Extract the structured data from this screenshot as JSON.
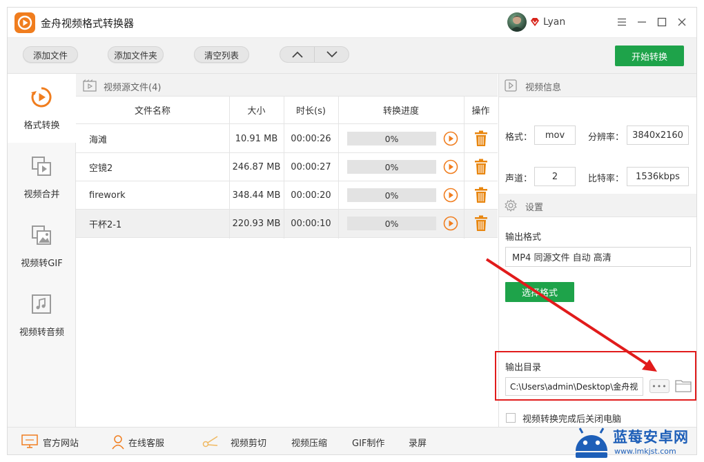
{
  "app": {
    "title": "金舟视频格式转换器",
    "username": "Lyan"
  },
  "toolbar": {
    "add_file": "添加文件",
    "add_folder": "添加文件夹",
    "clear_list": "清空列表",
    "start_convert": "开始转换"
  },
  "nav": [
    {
      "label": "格式转换",
      "icon": "format-convert-icon",
      "active": true
    },
    {
      "label": "视频合并",
      "icon": "video-merge-icon",
      "active": false
    },
    {
      "label": "视频转GIF",
      "icon": "video-gif-icon",
      "active": false
    },
    {
      "label": "视频转音频",
      "icon": "video-audio-icon",
      "active": false
    }
  ],
  "filelist": {
    "header": "视频源文件(4)",
    "columns": {
      "name": "文件名称",
      "size": "大小",
      "duration": "时长(s)",
      "progress": "转换进度",
      "action": "操作"
    },
    "rows": [
      {
        "name": "海滩",
        "size": "10.91 MB",
        "duration": "00:00:26",
        "progress": "0%"
      },
      {
        "name": "空镜2",
        "size": "246.87 MB",
        "duration": "00:00:27",
        "progress": "0%"
      },
      {
        "name": "firework",
        "size": "348.44 MB",
        "duration": "00:00:20",
        "progress": "0%"
      },
      {
        "name": "干杯2-1",
        "size": "220.93 MB",
        "duration": "00:00:10",
        "progress": "0%"
      }
    ]
  },
  "info": {
    "header": "视频信息",
    "format_label": "格式：",
    "format": "mov",
    "resolution_label": "分辨率：",
    "resolution": "3840x2160",
    "channels_label": "声道：",
    "channels": "2",
    "bitrate_label": "比特率：",
    "bitrate": "1536kbps"
  },
  "settings": {
    "header": "设置",
    "output_format_label": "输出格式",
    "output_format": "MP4 同源文件 自动 高清",
    "select_format": "选择格式",
    "output_dir_label": "输出目录",
    "output_dir": "C:\\Users\\admin\\Desktop\\金舟视",
    "more_button": "•••",
    "shutdown_label": "视频转换完成后关闭电脑"
  },
  "bottom": {
    "website": "官方网站",
    "support": "在线客服",
    "video_cut": "视频剪切",
    "video_compress": "视频压缩",
    "gif_make": "GIF制作",
    "record": "录屏"
  },
  "watermark": {
    "title": "蓝莓安卓网",
    "url": "www.lmkjst.com"
  },
  "colors": {
    "accent_green": "#1ea34a",
    "brand_orange": "#f07d1e",
    "highlight_red": "#e11b1b"
  }
}
